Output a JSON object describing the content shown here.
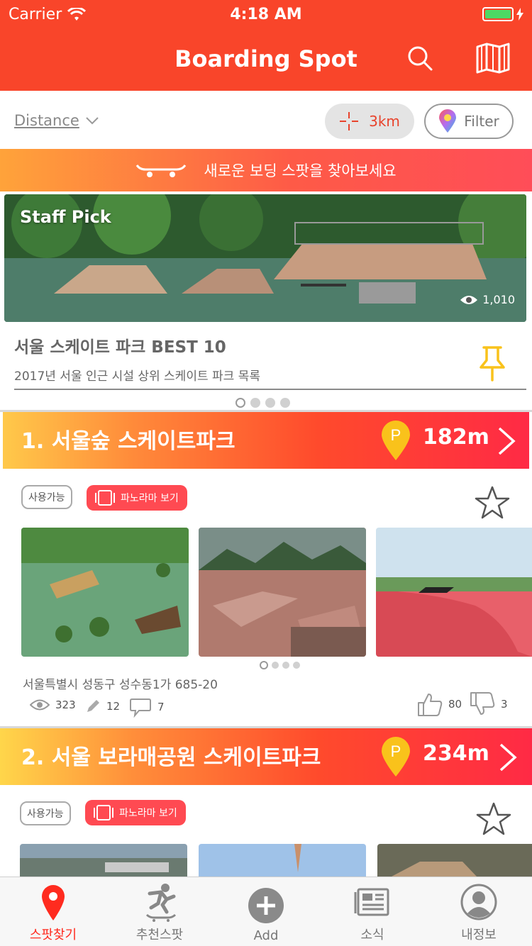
{
  "status_bar": {
    "carrier": "Carrier",
    "time": "4:18 AM"
  },
  "header": {
    "title": "Boarding Spot",
    "icons": [
      "search-icon",
      "map-icon"
    ]
  },
  "filter_bar": {
    "sort": "Distance",
    "radius": "3km",
    "filter": "Filter"
  },
  "banner": {
    "text": "새로운 보딩 스팟을 찾아보세요",
    "icon": "skateboard-icon"
  },
  "staff_pick": {
    "label": "Staff Pick",
    "views": "1,010",
    "title": "서울 스케이트 파크 BEST 10",
    "description": "2017년 서울 인근 시설 상위 스케이트 파크 목록",
    "page_count": 4,
    "active_page": 0
  },
  "spots": [
    {
      "name": "1. 서울숲 스케이트파크",
      "distance": "182m",
      "status": "사용가능",
      "panorama": "파노라마 보기",
      "address": "서울특별시 성동구 성수동1가 685-20",
      "views": "323",
      "edits": "12",
      "comments": "7",
      "likes": "80",
      "dislikes": "3"
    },
    {
      "name": "2. 서울 보라매공원 스케이트파크",
      "distance": "234m",
      "status": "사용가능",
      "panorama": "파노라마 보기"
    }
  ],
  "tabs": [
    {
      "label": "스팟찾기",
      "icon": "location-pin-icon",
      "active": true
    },
    {
      "label": "추천스팟",
      "icon": "skater-icon",
      "active": false
    },
    {
      "label": "Add",
      "icon": "add-circle-icon",
      "active": false
    },
    {
      "label": "소식",
      "icon": "news-icon",
      "active": false
    },
    {
      "label": "내정보",
      "icon": "profile-icon",
      "active": false
    }
  ],
  "colors": {
    "header": "#f9452a",
    "accent": "#ff2b1f",
    "pin": "#f9c21b"
  }
}
